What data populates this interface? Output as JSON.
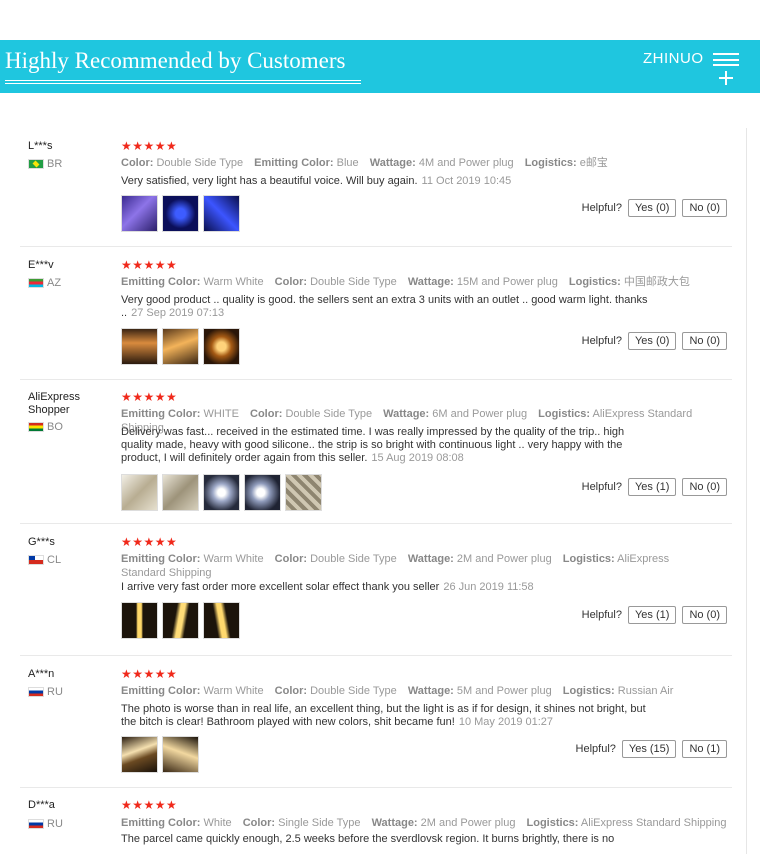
{
  "header": {
    "title": "Highly Recommended by Customers",
    "brand": "ZHINUO",
    "menu_icon": "hamburger-icon",
    "plus_icon": "plus-icon",
    "accent_color": "#1fc6df"
  },
  "helpful_label": "Helpful?",
  "star_color": "#f0291b",
  "reviews": [
    {
      "user": "L***s",
      "country": "BR",
      "stars": "★★★★★",
      "attributes": [
        {
          "label": "Color:",
          "value": "Double Side Type"
        },
        {
          "label": "Emitting Color:",
          "value": "Blue"
        },
        {
          "label": "Wattage:",
          "value": "4M and Power plug"
        },
        {
          "label": "Logistics:",
          "value": "e邮宝"
        }
      ],
      "text": "Very satisfied, very light has a beautiful voice. Will buy again.",
      "date": "11 Oct 2019 10:45",
      "yes": "Yes (0)",
      "no": "No (0)"
    },
    {
      "user": "E***v",
      "country": "AZ",
      "stars": "★★★★★",
      "attributes": [
        {
          "label": "Emitting Color:",
          "value": "Warm White"
        },
        {
          "label": "Color:",
          "value": "Double Side Type"
        },
        {
          "label": "Wattage:",
          "value": "15M and Power plug"
        },
        {
          "label": "Logistics:",
          "value": "中国邮政大包"
        }
      ],
      "text": "Very good product .. quality is good. the sellers sent an extra 3 units with an outlet .. good warm light. thanks ..",
      "date": "27 Sep 2019 07:13",
      "yes": "Yes (0)",
      "no": "No (0)"
    },
    {
      "user": "AliExpress Shopper",
      "country": "BO",
      "stars": "★★★★★",
      "attributes": [
        {
          "label": "Emitting Color:",
          "value": "WHITE"
        },
        {
          "label": "Color:",
          "value": "Double Side Type"
        },
        {
          "label": "Wattage:",
          "value": "6M and Power plug"
        },
        {
          "label": "Logistics:",
          "value": "AliExpress Standard Shipping"
        }
      ],
      "text": "Delivery was fast... received in the estimated time. I was really impressed by the quality of the trip.. high quality made, heavy with good silicone.. the strip is so bright with continuous light .. very happy with the product, I will definitely order again from this seller.",
      "date": "15 Aug 2019 08:08",
      "yes": "Yes (1)",
      "no": "No (0)"
    },
    {
      "user": "G***s",
      "country": "CL",
      "stars": "★★★★★",
      "attributes": [
        {
          "label": "Emitting Color:",
          "value": "Warm White"
        },
        {
          "label": "Color:",
          "value": "Double Side Type"
        },
        {
          "label": "Wattage:",
          "value": "2M and Power plug"
        },
        {
          "label": "Logistics:",
          "value": "AliExpress Standard Shipping"
        }
      ],
      "text": "I arrive very fast order more excellent solar effect thank you seller",
      "date": "26 Jun 2019 11:58",
      "yes": "Yes (1)",
      "no": "No (0)"
    },
    {
      "user": "A***n",
      "country": "RU",
      "stars": "★★★★★",
      "attributes": [
        {
          "label": "Emitting Color:",
          "value": "Warm White"
        },
        {
          "label": "Color:",
          "value": "Double Side Type"
        },
        {
          "label": "Wattage:",
          "value": "5M and Power plug"
        },
        {
          "label": "Logistics:",
          "value": "Russian Air"
        }
      ],
      "text": "The photo is worse than in real life, an excellent thing, but the light is as if for design, it shines not bright, but the bitch is clear! Bathroom played with new colors, shit became fun!",
      "date": "10 May 2019 01:27",
      "yes": "Yes (15)",
      "no": "No (1)"
    },
    {
      "user": "D***a",
      "country": "RU",
      "stars": "★★★★★",
      "attributes": [
        {
          "label": "Emitting Color:",
          "value": "White"
        },
        {
          "label": "Color:",
          "value": "Single Side Type"
        },
        {
          "label": "Wattage:",
          "value": "2M and Power plug"
        },
        {
          "label": "Logistics:",
          "value": "AliExpress Standard Shipping"
        }
      ],
      "text": "The parcel came quickly enough, 2.5 weeks before the sverdlovsk region. It burns brightly, there is no",
      "date": "",
      "yes": "",
      "no": ""
    }
  ]
}
